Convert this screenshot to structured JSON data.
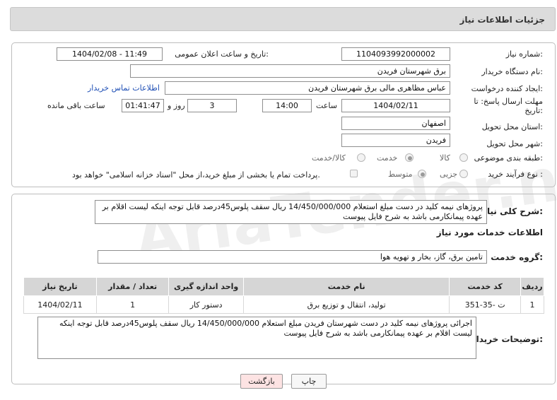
{
  "header": {
    "title": "جزئیات اطلاعات نیاز"
  },
  "watermark": "AriaTender.neT",
  "form": {
    "need_number_label": "شماره نیاز:",
    "need_number": "1104093992000002",
    "announce_label": "تاریخ و ساعت اعلان عمومی:",
    "announce_value": "1404/02/08 - 11:49",
    "buyer_org_label": "نام دستگاه خریدار:",
    "buyer_org": "برق شهرستان فریدن",
    "creator_label": "ایجاد کننده درخواست:",
    "creator": "عباس مظاهری مالی برق شهرستان فریدن",
    "contact_link": "اطلاعات تماس خریدار",
    "deadline_label": "مهلت ارسال پاسخ: تا تاریخ:",
    "deadline_date": "1404/02/11",
    "time_label": "ساعت",
    "deadline_time": "14:00",
    "days_value": "3",
    "days_label": "روز و",
    "remaining_time": "01:41:47",
    "remaining_label": "ساعت باقی مانده",
    "province_label": "استان محل تحویل:",
    "province": "اصفهان",
    "city_label": "شهر محل تحویل:",
    "city": "فریدن",
    "category_label": "طبقه بندی موضوعی:",
    "category_options": [
      "کالا",
      "خدمت",
      "کالا/خدمت"
    ],
    "category_selected": "خدمت",
    "process_label": "نوع فرآیند خرید :",
    "process_options": [
      "جزیی",
      "متوسط"
    ],
    "process_selected": "متوسط",
    "payment_note": "پرداخت تمام یا بخشی از مبلغ خرید،از محل \"اسناد خزانه اسلامی\" خواهد بود."
  },
  "summary": {
    "label": "شرح کلی نیاز:",
    "text": "پروژهای نیمه کلید در دست مبلغ استعلام 14/450/000/000 ریال سقف پلوس45درصد قابل توجه اینکه لیست اقلام بر عهده پیمانکارمی باشد به شرح فایل پیوست"
  },
  "services": {
    "section_title": "اطلاعات خدمات مورد نیاز",
    "group_label": "گروه خدمت:",
    "group_value": "تامین برق، گاز، بخار و تهویه هوا",
    "columns": [
      "ردیف",
      "کد خدمت",
      "نام خدمت",
      "واحد اندازه گیری",
      "تعداد / مقدار",
      "تاریخ نیاز"
    ],
    "rows": [
      [
        "1",
        "ت -35-351",
        "تولید، انتقال و توزیع برق",
        "دستور کار",
        "1",
        "1404/02/11"
      ]
    ]
  },
  "buyer_notes": {
    "label": "توضیحات خریدار:",
    "text": "اجرائی پروژهای نیمه کلید در دست شهرستان فریدن مبلغ استعلام 14/450/000/000 ریال سقف پلوس45درصد قابل توجه اینکه لیست اقلام بر عهده پیمانکارمی باشد به شرح فایل پیوست"
  },
  "buttons": {
    "print": "چاپ",
    "back": "بازگشت"
  }
}
